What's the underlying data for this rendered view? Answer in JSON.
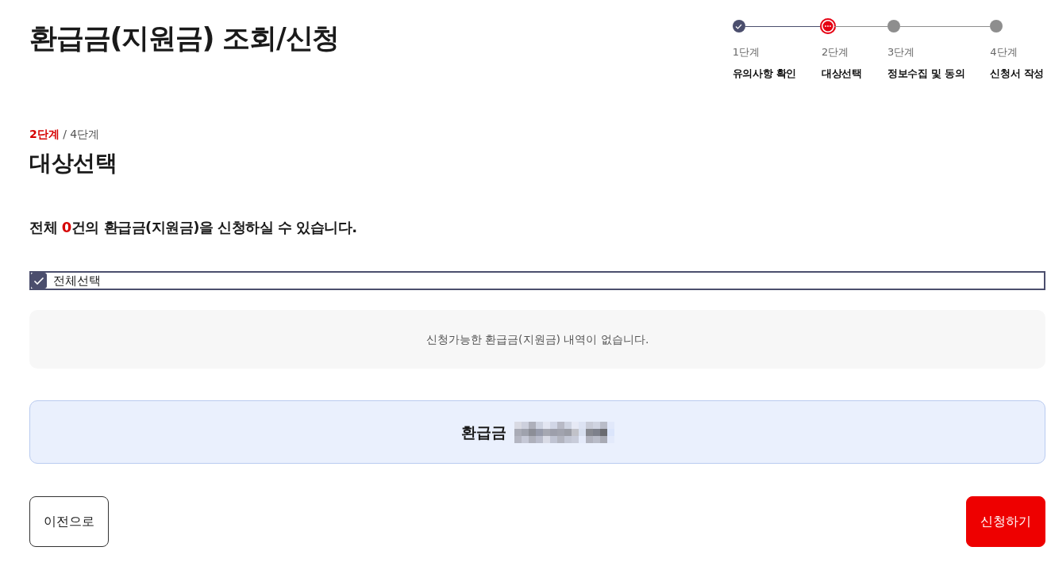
{
  "page": {
    "title": "환급금(지원금) 조회/신청"
  },
  "stepper": {
    "steps": [
      {
        "label": "1단계",
        "name": "유의사항 확인",
        "completed": true,
        "selected": false
      },
      {
        "label": "2단계",
        "name": "대상선택",
        "completed": false,
        "selected": true
      },
      {
        "label": "3단계",
        "name": "정보수집 및 동의",
        "completed": false,
        "selected": false
      },
      {
        "label": "4단계",
        "name": "신청서 작성",
        "completed": false,
        "selected": false
      }
    ]
  },
  "section": {
    "step_counter": "**2단계** / 4단계",
    "heading": "대상선택"
  },
  "summary": {
    "prefix": "전체 ",
    "count": "0",
    "suffix": "건의 환급금(지원금)을 신청하실 수 있습니다."
  },
  "select_all": {
    "label": "전체선택",
    "checked": true
  },
  "empty_message": "신청가능한 환급금(지원금) 내역이 없습니다.",
  "total_box": {
    "label": "환급금"
  },
  "buttons": [
    {
      "label": "이전으로",
      "kind": "secondary"
    },
    {
      "label": "신청하기",
      "kind": "primary"
    }
  ]
}
